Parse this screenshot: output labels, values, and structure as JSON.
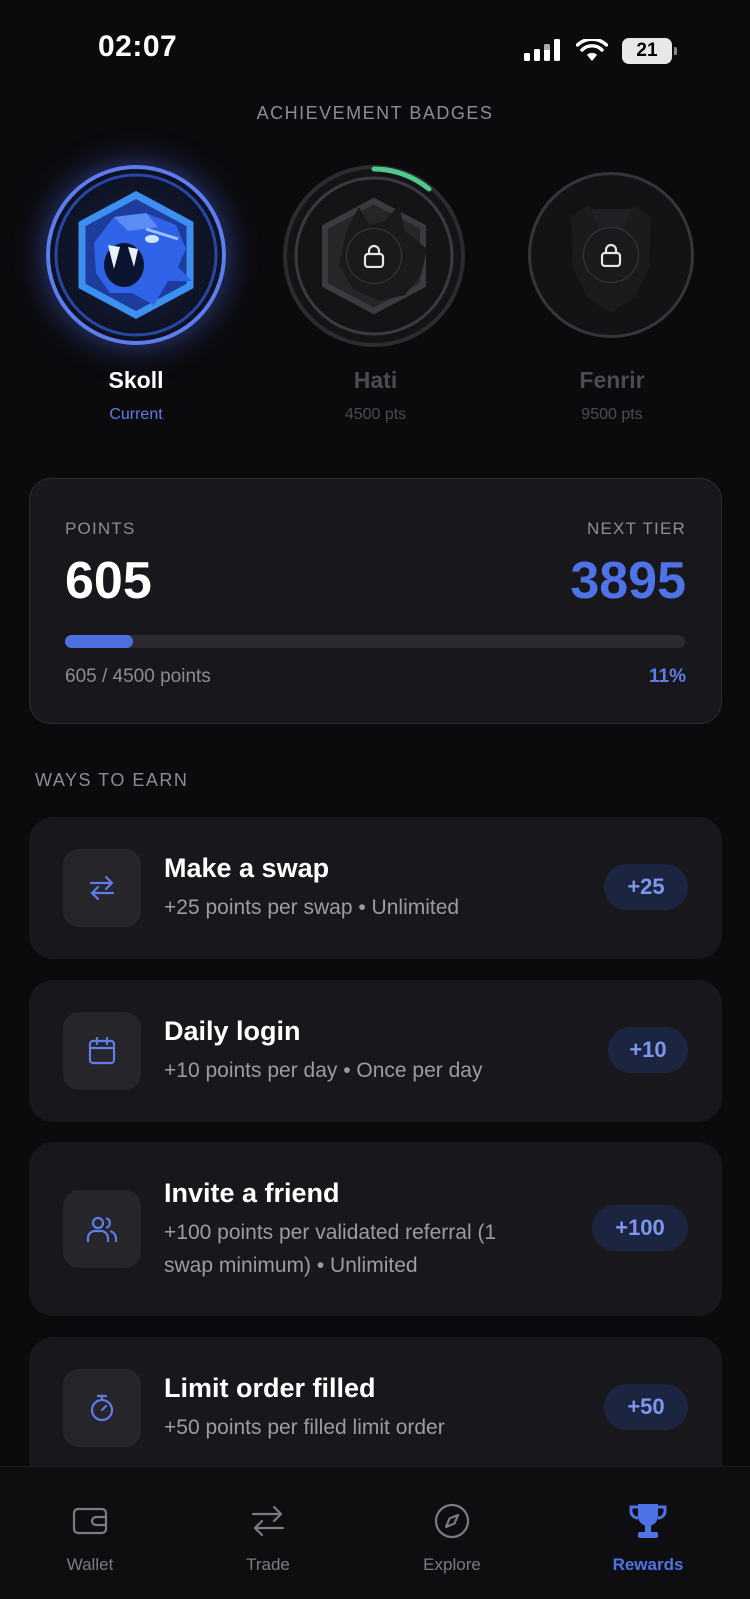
{
  "status_bar": {
    "time": "02:07",
    "battery": "21"
  },
  "achievements": {
    "heading": "ACHIEVEMENT BADGES",
    "badges": [
      {
        "name": "Skoll",
        "subtitle": "Current",
        "locked": false
      },
      {
        "name": "Hati",
        "subtitle": "4500 pts",
        "locked": true
      },
      {
        "name": "Fenrir",
        "subtitle": "9500 pts",
        "locked": true
      }
    ]
  },
  "points": {
    "label": "POINTS",
    "value": "605",
    "next_tier_label": "NEXT TIER",
    "next_tier_value": "3895",
    "progress_text": "605 / 4500 points",
    "percent_text": "11%",
    "progress_fraction": 0.11
  },
  "earn": {
    "heading": "WAYS TO EARN",
    "items": [
      {
        "title": "Make a swap",
        "description": "+25 points per swap • Unlimited",
        "reward": "+25",
        "icon": "swap-arrows-icon"
      },
      {
        "title": "Daily login",
        "description": "+10 points per day • Once per day",
        "reward": "+10",
        "icon": "calendar-icon"
      },
      {
        "title": "Invite a friend",
        "description_line1": "+100 points per validated referral (1",
        "description_line2": "swap minimum) • Unlimited",
        "reward": "+100",
        "icon": "users-icon"
      },
      {
        "title": "Limit order filled",
        "description": "+50 points per filled limit order",
        "reward": "+50",
        "icon": "stopwatch-icon"
      }
    ]
  },
  "nav": {
    "items": [
      {
        "label": "Wallet",
        "icon": "wallet-icon"
      },
      {
        "label": "Trade",
        "icon": "transfer-arrows-icon"
      },
      {
        "label": "Explore",
        "icon": "compass-icon"
      },
      {
        "label": "Rewards",
        "icon": "trophy-icon",
        "active": true
      }
    ]
  },
  "colors": {
    "accent": "#4f73e6",
    "background": "#0b0b0e",
    "card": "#18181c",
    "progress_green": "#4fc98a"
  }
}
